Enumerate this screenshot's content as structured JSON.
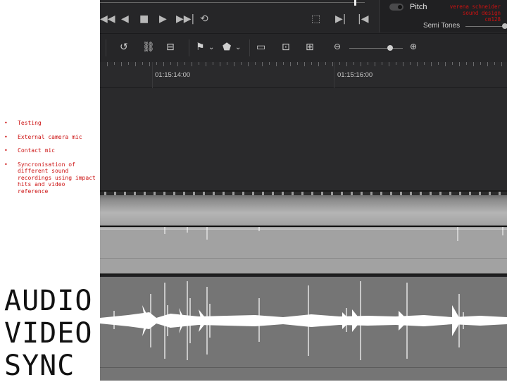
{
  "slide": {
    "bullets": [
      "Testing",
      "External camera mic",
      "Contact mic",
      "Syncronisation of different sound recordings using impact hits and video reference"
    ],
    "title_lines": [
      "AUDIO",
      "VIDEO",
      "SYNC"
    ]
  },
  "inspector": {
    "pitch_label": "Pitch",
    "credit_lines": [
      "verena schneider",
      "sound design",
      "cm128"
    ],
    "semitones_label": "Semi Tones"
  },
  "timeline": {
    "timecodes": [
      "01:15:14:00",
      "01:15:16:00"
    ]
  },
  "icons": {
    "transport": [
      "rewind-icon",
      "step-back-icon",
      "stop-icon",
      "play-icon",
      "fast-forward-icon",
      "loop-icon",
      "fullscreen-icon",
      "next-clip-icon",
      "prev-clip-icon"
    ],
    "toolbar": [
      "snap-icon",
      "link-icon",
      "lock-icon",
      "flag-icon",
      "marker-icon",
      "zoom-full-icon",
      "zoom-detail-icon",
      "zoom-custom-icon",
      "zoom-out-icon",
      "zoom-in-icon"
    ]
  },
  "colors": {
    "accent_red": "#cc1111",
    "editor_bg": "#28282a",
    "waveform": "#ffffff"
  }
}
